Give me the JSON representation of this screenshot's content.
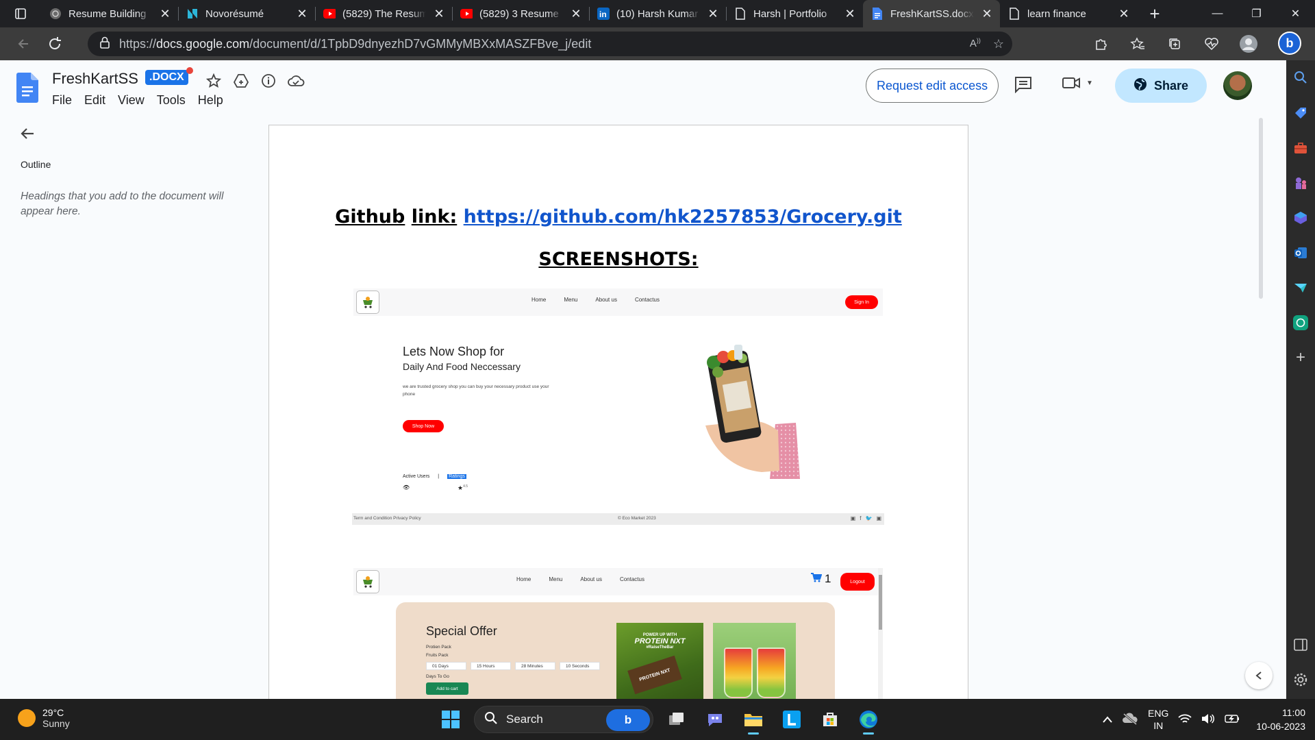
{
  "browser": {
    "tabs": [
      {
        "title": "Resume Building",
        "icon": "chatgpt-icon",
        "active": false
      },
      {
        "title": "Novorésumé",
        "icon": "novoresume-icon",
        "active": false
      },
      {
        "title": "(5829) The Resum",
        "icon": "youtube-icon",
        "active": false
      },
      {
        "title": "(5829) 3 Resume",
        "icon": "youtube-icon",
        "active": false
      },
      {
        "title": "(10) Harsh Kumar",
        "icon": "linkedin-icon",
        "active": false
      },
      {
        "title": "Harsh | Portfolio",
        "icon": "page-icon",
        "active": false
      },
      {
        "title": "FreshKartSS.docx",
        "icon": "docs-icon",
        "active": true
      },
      {
        "title": "learn finance",
        "icon": "page-icon",
        "active": false
      }
    ],
    "url_prefix": "https://",
    "url_host": "docs.google.com",
    "url_path": "/document/d/1TpbD9dnyezhD7vGMMyMBXxMASZFBve_j/edit"
  },
  "docs": {
    "title": "FreshKartSS",
    "badge": ".DOCX",
    "menu": [
      "File",
      "Edit",
      "View",
      "Tools",
      "Help"
    ],
    "request_edit": "Request edit access",
    "share": "Share"
  },
  "outline": {
    "title": "Outline",
    "hint": "Headings that you add to the document will appear here."
  },
  "document": {
    "github_word": "Github",
    "link_word": "link:",
    "github_url": "https://github.com/hk2257853/Grocery.git",
    "screenshots_heading": "SCREENSHOTS:",
    "shot1": {
      "nav": [
        "Home",
        "Menu",
        "About us",
        "Contactus"
      ],
      "signin": "Sign In",
      "heading1": "Lets Now Shop for",
      "heading2": "Daily And Food Neccessary",
      "para": "we are trusted grocery shop you can buy your necessary product use your phone",
      "shop_now": "Shop Now",
      "stat1": "Active Users",
      "stat_sep": "|",
      "stat2": "Ratings",
      "rating": "4.5",
      "footer_left": "Term and Condition  Privacy Policy",
      "footer_center": "© Eco Market 2023"
    },
    "shot2": {
      "nav": [
        "Home",
        "Menu",
        "About us",
        "Contactus"
      ],
      "cart_count": "1",
      "logout": "Logout",
      "offer_title": "Special Offer",
      "line1": "Protien Pack",
      "line2": "Fruits Pack",
      "timer": [
        "01 Days",
        "15 Hours",
        "28 Minutes",
        "10 Seconds"
      ],
      "days_to_go": "Days To Go",
      "add_to_cart": "Add to cart",
      "protein_tag": "POWER UP WITH",
      "protein_name": "PROTEIN NXT",
      "protein_hashtag": "#RaiseTheBar",
      "bar_label": "PROTEIN NXT"
    }
  },
  "taskbar": {
    "temp": "29°C",
    "condition": "Sunny",
    "search": "Search",
    "lang1": "ENG",
    "lang2": "IN",
    "time": "11:00",
    "date": "10-06-2023"
  },
  "colors": {
    "accent": "#1a73e8",
    "share_bg": "#c2e7ff",
    "red_button": "#ff0000",
    "offer_bg": "#efdcca"
  }
}
